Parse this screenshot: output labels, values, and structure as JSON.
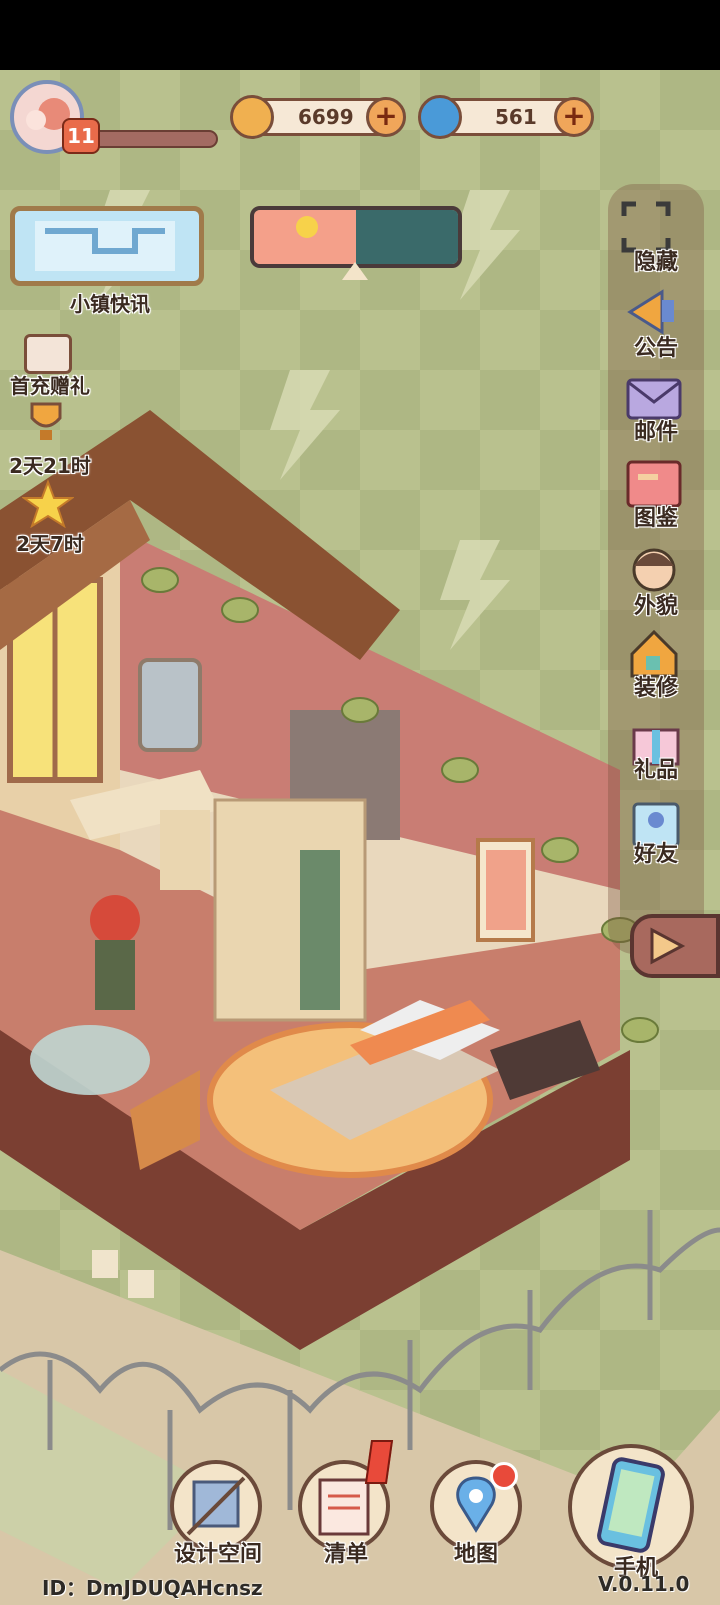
{
  "status_bar": {},
  "player": {
    "level": "11"
  },
  "currency": {
    "coins": "6699",
    "gems": "561"
  },
  "news": {
    "label": "小镇快讯"
  },
  "left_events": [
    {
      "label": "首充赠礼"
    },
    {
      "label": "2天21时"
    },
    {
      "label": "2天7时"
    }
  ],
  "side_menu": [
    {
      "label": "隐藏",
      "icon": "hide-icon"
    },
    {
      "label": "公告",
      "icon": "announcement-icon"
    },
    {
      "label": "邮件",
      "icon": "mail-icon"
    },
    {
      "label": "图鉴",
      "icon": "album-icon"
    },
    {
      "label": "外貌",
      "icon": "appearance-icon"
    },
    {
      "label": "装修",
      "icon": "renovate-icon"
    },
    {
      "label": "礼品",
      "icon": "gift-icon"
    },
    {
      "label": "好友",
      "icon": "friends-icon"
    }
  ],
  "bottom_nav": [
    {
      "label": "设计空间",
      "icon": "design-space-icon"
    },
    {
      "label": "清单",
      "icon": "list-icon"
    },
    {
      "label": "地图",
      "icon": "map-icon"
    },
    {
      "label": "手机",
      "icon": "phone-icon"
    }
  ],
  "footer": {
    "id_text": "ID：DmJDUQAHcnsz",
    "version": "V.0.11.0"
  },
  "colors": {
    "background": "#b9c18e",
    "wall": "#c97d74",
    "floor": "#c87e6c",
    "accent": "#f0a65a"
  }
}
